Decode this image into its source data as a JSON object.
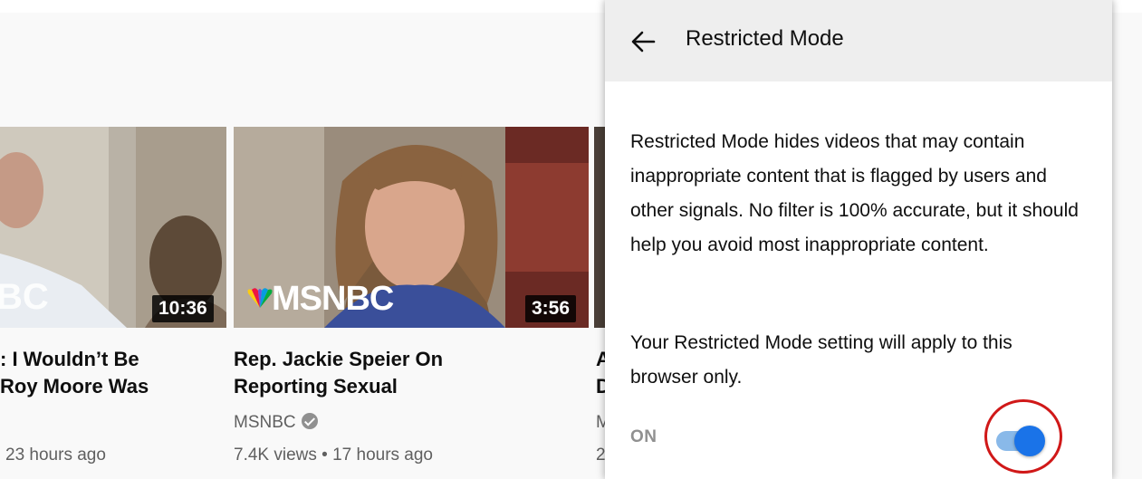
{
  "cards": [
    {
      "duration": "10:36",
      "title": ": I Wouldn’t Be\nRoy Moore Was",
      "meta": "23 hours ago",
      "thumb_overlay": "BC"
    },
    {
      "duration": "3:56",
      "title": "Rep. Jackie Speier On\nReporting Sexual",
      "channel": "MSNBC",
      "meta": "7.4K views • 17 hours ago",
      "thumb_overlay": "MSNBC"
    },
    {
      "title_fragment": "A\nD",
      "channel_fragment": "M",
      "meta_fragment": "2"
    }
  ],
  "panel": {
    "back_icon": "arrow-back-icon",
    "title": "Restricted Mode",
    "description": "Restricted Mode hides videos that may contain inappropriate content that is flagged by users and other signals. No filter is 100% accurate, but it should help you avoid most inappropriate content.",
    "note": "Your Restricted Mode setting will apply to this browser only.",
    "toggle_label": "ON",
    "toggle_state": true,
    "toggle_color": "#1a73e8",
    "highlight_color": "#d01818"
  }
}
